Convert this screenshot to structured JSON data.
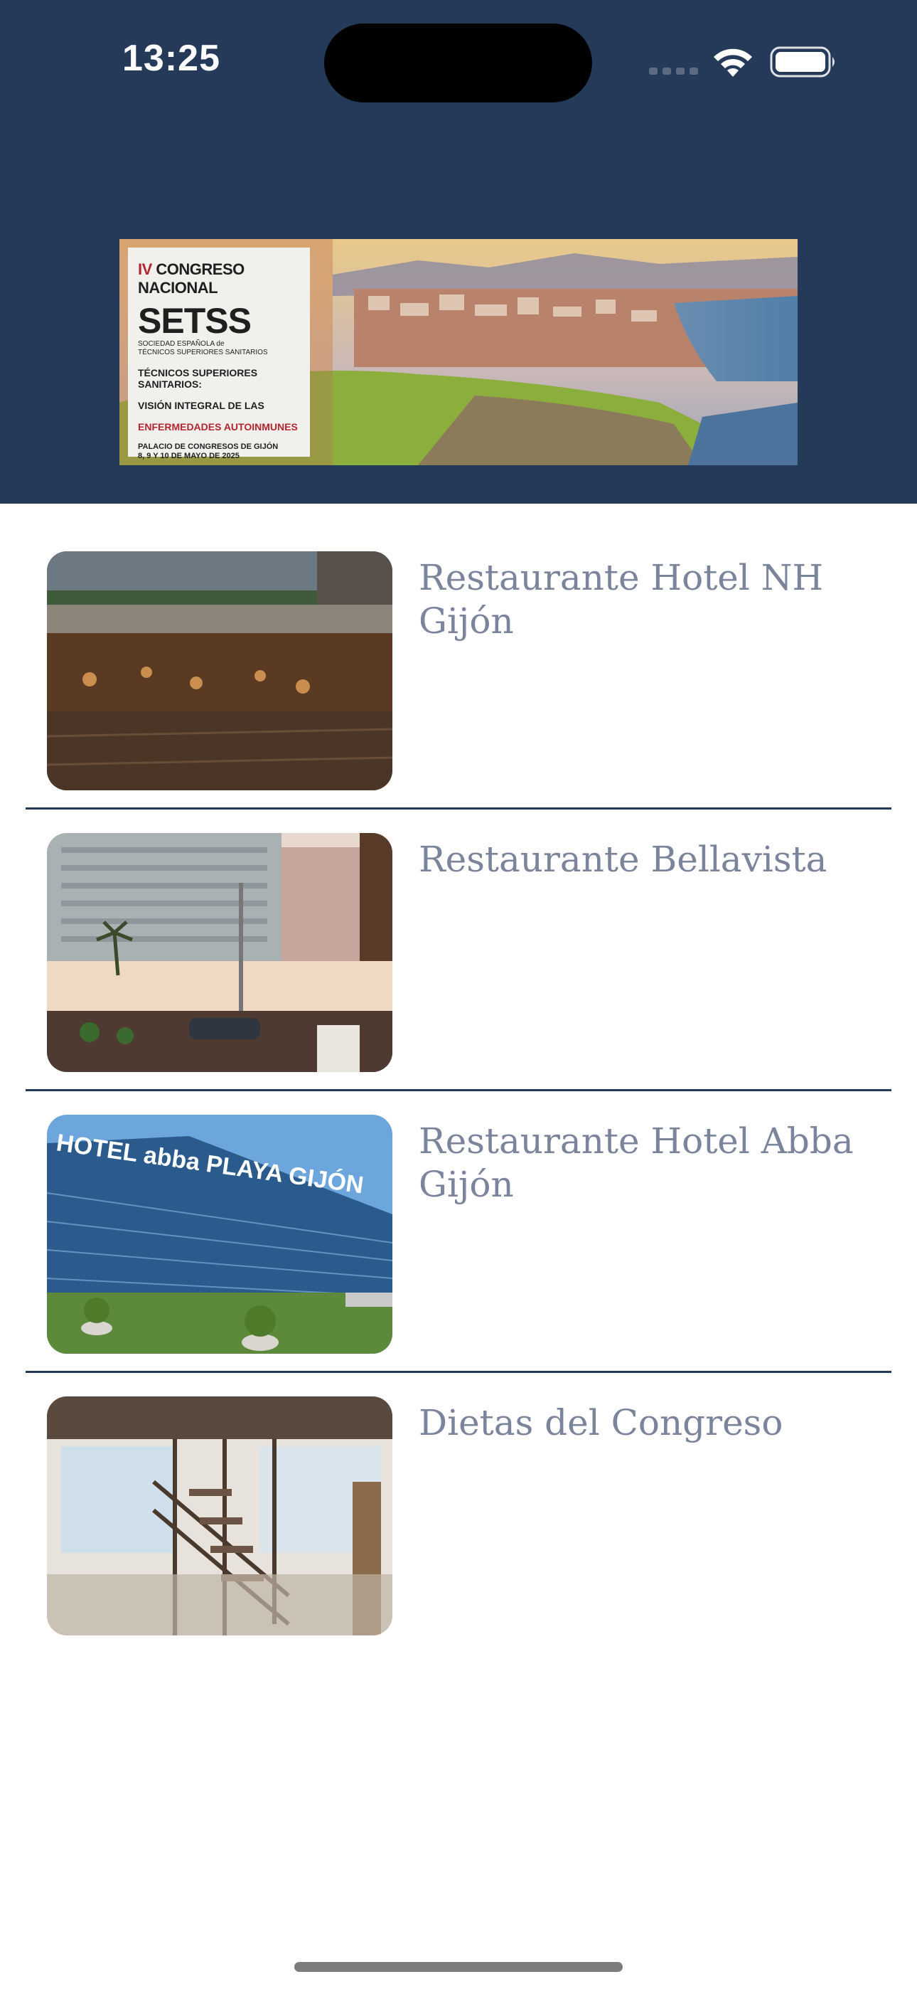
{
  "status_bar": {
    "time": "13:25"
  },
  "banner": {
    "roman_numeral": "IV",
    "event_line": "CONGRESO NACIONAL",
    "brand": "SETSS",
    "society_line1": "SOCIEDAD ESPAÑOLA de",
    "society_line2": "TÉCNICOS SUPERIORES SANITARIOS",
    "subtitle1": "TÉCNICOS SUPERIORES SANITARIOS:",
    "subtitle2": "VISIÓN INTEGRAL DE LAS",
    "subtitle3": "ENFERMEDADES AUTOINMUNES",
    "venue": "PALACIO DE CONGRESOS DE GIJÓN",
    "dates": "8, 9 Y 10 DE MAYO DE 2025"
  },
  "restaurants": [
    {
      "title": "Restaurante Hotel NH Gijón",
      "image": "nh-terrace-photo"
    },
    {
      "title": "Restaurante Bellavista",
      "image": "beach-terrace-photo"
    },
    {
      "title": "Restaurante Hotel Abba Gijón",
      "image": "abba-hotel-photo"
    },
    {
      "title": "Dietas del Congreso",
      "image": "congress-staircase-photo"
    }
  ],
  "colors": {
    "header_bg": "#243a58",
    "title_text": "#7a849b",
    "divider": "#243a58",
    "background": "#ffffff"
  }
}
